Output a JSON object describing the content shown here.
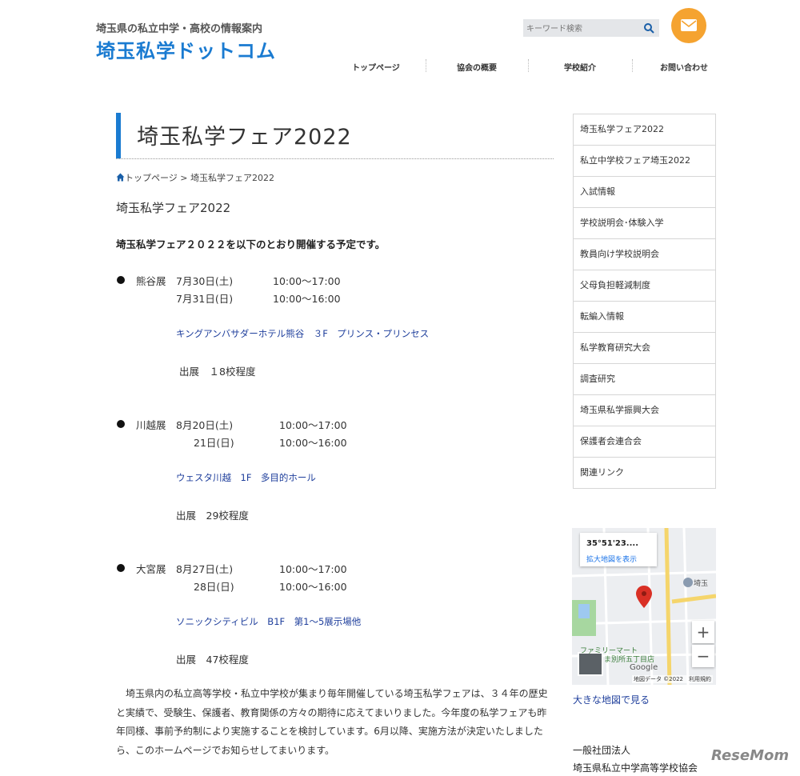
{
  "header": {
    "tagline": "埼玉県の私立中学・高校の情報案内",
    "logo": "埼玉私学ドットコム",
    "search_placeholder": "キーワード検索",
    "nav": [
      "トップページ",
      "協会の概要",
      "学校紹介",
      "お問い合わせ"
    ]
  },
  "main": {
    "title": "埼玉私学フェア2022",
    "breadcrumb": {
      "home": "トップページ",
      "sep": ">",
      "current": "埼玉私学フェア2022"
    },
    "subtitle": "埼玉私学フェア2022",
    "intro": "埼玉私学フェア２０２２を以下のとおり開催する予定です。",
    "fairs": [
      {
        "name": "熊谷展",
        "date1": "7月30日(土)",
        "time1": "10:00～17:00",
        "date2": "7月31日(日)",
        "time2": "10:00～16:00",
        "venue": "キングアンバサダーホテル熊谷　３F　プリンス・プリンセス",
        "exhibit": "出展　１8校程度"
      },
      {
        "name": "川越展",
        "date1": "8月20日(土)",
        "time1": "10:00～17:00",
        "date2": "21日(日)",
        "time2": "10:00～16:00",
        "venue": "ウェスタ川越　1F　多目的ホール",
        "exhibit": "出展　29校程度"
      },
      {
        "name": "大宮展",
        "date1": "8月27日(土)",
        "time1": "10:00～17:00",
        "date2": "28日(日)",
        "time2": "10:00～16:00",
        "venue": "ソニックシティビル　B1F　第1～5展示場他",
        "exhibit": "出展　47校程度"
      }
    ],
    "description": "　埼玉県内の私立高等学校・私立中学校が集まり毎年開催している埼玉私学フェアは、３４年の歴史と実績で、受験生、保護者、教育関係の方々の期待に応えてまいりました。今年度の私学フェアも昨年同様、事前予約制により実施することを検討しています。6月以降、実施方法が決定いたしましたら、このホームページでお知らせしてまいります。"
  },
  "sidebar": {
    "items": [
      "埼玉私学フェア2022",
      "私立中学校フェア埼玉2022",
      "入試情報",
      "学校説明会･体験入学",
      "教員向け学校説明会",
      "父母負担軽減制度",
      "転編入情報",
      "私学教育研究大会",
      "調査研究",
      "埼玉県私学振興大会",
      "保護者会連合会",
      "関連リンク"
    ],
    "map": {
      "coord": "35°51'23....",
      "expand": "拡大地図を表示",
      "zoom_in": "+",
      "zoom_out": "−",
      "poi1": "ファミリーマート",
      "poi2": "ま別所五丁目店",
      "poi3": "埼玉",
      "google": "Google",
      "credit": "地図データ ©2022　利用規約"
    },
    "big_map": "大きな地図で見る",
    "org_label": "一般社団法人",
    "org_name": "埼玉県私立中学高等学校協会"
  },
  "watermark": "ReseMom",
  "colors": {
    "accent": "#1a7bd1",
    "mail": "#f5a330",
    "link": "#1f3f9c"
  }
}
